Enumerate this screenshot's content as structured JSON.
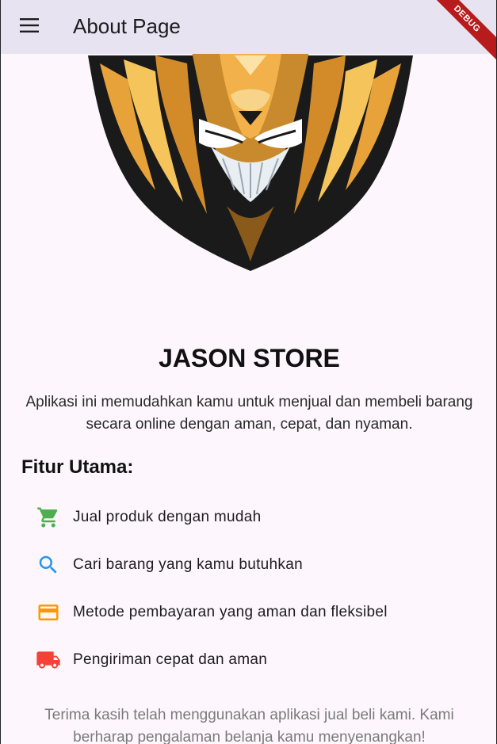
{
  "appbar": {
    "title": "About Page",
    "menu_icon": "menu-icon",
    "debug_label": "DEBUG"
  },
  "logo": {
    "icon": "lion-head-logo"
  },
  "store": {
    "name": "JASON STORE",
    "description": "Aplikasi ini memudahkan kamu untuk menjual dan membeli barang secara online dengan aman, cepat, dan nyaman."
  },
  "features": {
    "title": "Fitur Utama:",
    "items": [
      {
        "label": "Jual produk dengan mudah",
        "icon": "shopping-cart-icon",
        "color": "#4caf50"
      },
      {
        "label": "Cari barang yang kamu butuhkan",
        "icon": "search-icon",
        "color": "#2196f3"
      },
      {
        "label": "Metode pembayaran yang aman dan fleksibel",
        "icon": "credit-card-icon",
        "color": "#ff9800"
      },
      {
        "label": "Pengiriman cepat dan aman",
        "icon": "delivery-truck-icon",
        "color": "#f44336"
      }
    ]
  },
  "footer": {
    "thanks": "Terima kasih telah menggunakan aplikasi jual beli kami. Kami berharap pengalaman belanja kamu menyenangkan!"
  },
  "colors": {
    "appbar_bg": "#e8e3f0",
    "page_bg": "#fdf7fd",
    "debug_ribbon": "#b71c1c"
  }
}
